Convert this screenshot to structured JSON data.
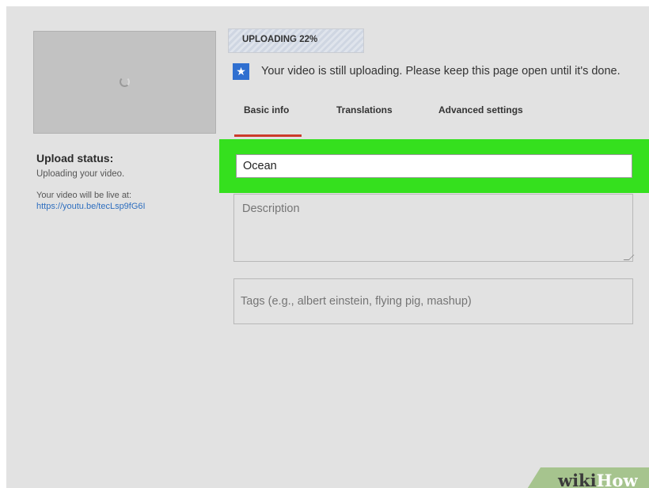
{
  "upload": {
    "progress_label": "UPLOADING 22%",
    "progress_fraction": 0.22,
    "notice": "Your video is still uploading. Please keep this page open until it's done."
  },
  "tabs": [
    {
      "label": "Basic info",
      "active": true
    },
    {
      "label": "Translations",
      "active": false
    },
    {
      "label": "Advanced settings",
      "active": false
    }
  ],
  "status": {
    "title": "Upload status:",
    "text": "Uploading your video.",
    "live_text": "Your video will be live at:",
    "link": "https://youtu.be/tecLsp9fG6I"
  },
  "form": {
    "title_value": "Ocean",
    "description_placeholder": "Description",
    "tags_placeholder": "Tags (e.g., albert einstein, flying pig, mashup)"
  },
  "watermark": {
    "wiki": "wiki",
    "how": "How"
  },
  "colors": {
    "highlight": "#35e01e",
    "tab_underline": "#cc3b2a",
    "star_badge": "#2f6fd0",
    "link": "#2f6fbf"
  },
  "icons": {
    "star": "star-icon",
    "spinner": "loading-spinner-icon"
  }
}
